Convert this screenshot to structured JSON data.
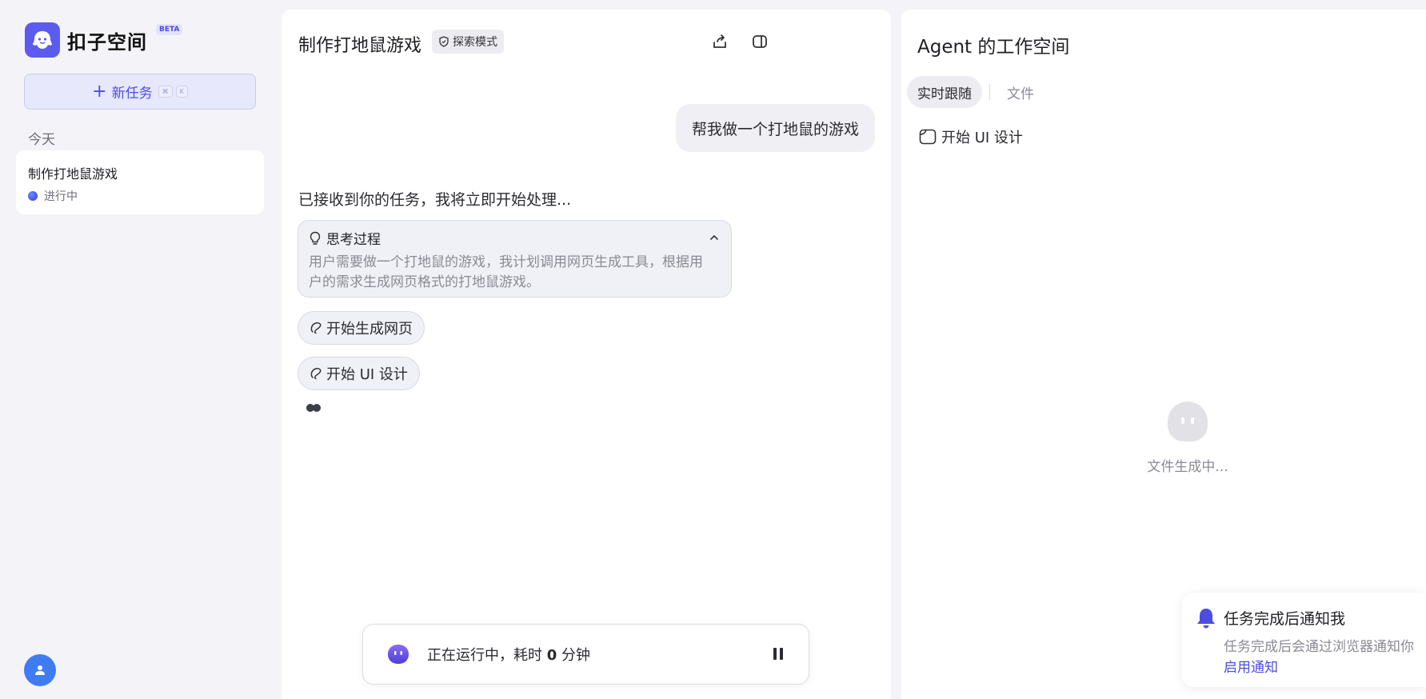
{
  "app": {
    "name": "扣子空间",
    "beta_badge": "BETA"
  },
  "sidebar": {
    "new_task_label": "新任务",
    "shortcut_keys": [
      "⌘",
      "K"
    ],
    "section_today": "今天",
    "tasks": [
      {
        "title": "制作打地鼠游戏",
        "status": "进行中",
        "status_color": "#3b4ee0"
      }
    ]
  },
  "chat": {
    "title": "制作打地鼠游戏",
    "mode_badge": "探索模式",
    "user_message": "帮我做一个打地鼠的游戏",
    "reply": "已接收到你的任务，我将立即开始处理...",
    "thinking": {
      "label": "思考过程",
      "line1": "用户需要做一个打地鼠的游戏，我计划调用网页生成工具，根据用",
      "line2": "户的需求生成网页格式的打地鼠游戏。"
    },
    "steps": [
      "开始生成网页",
      "开始 UI 设计"
    ],
    "run_status": {
      "prefix": "正在运行中，耗时 ",
      "minutes": "0",
      "suffix": " 分钟"
    }
  },
  "workspace": {
    "title": "Agent 的工作空间",
    "tabs": [
      "实时跟随",
      "文件"
    ],
    "active_tab": "实时跟随",
    "current_step": "开始 UI 设计",
    "placeholder": "文件生成中..."
  },
  "notification": {
    "title": "任务完成后通知我",
    "description": "任务完成后会通过浏览器通知你",
    "action": "启用通知"
  },
  "colors": {
    "accent": "#4b4de0",
    "avatar": "#3f7cf3",
    "background": "#f4f4f8"
  }
}
